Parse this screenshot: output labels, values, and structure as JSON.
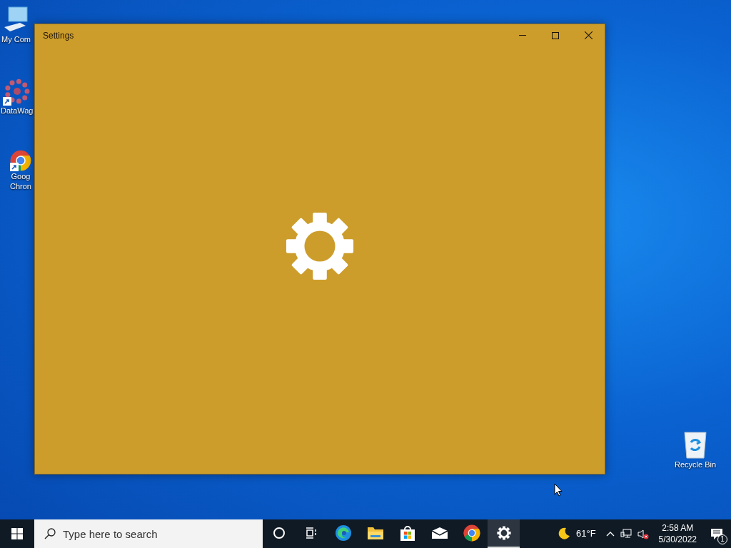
{
  "desktop_icons": [
    {
      "kind": "computer",
      "lines": [
        "My Com"
      ],
      "shortcut": false
    },
    {
      "kind": "network",
      "lines": [
        "DataWag"
      ],
      "shortcut": true
    },
    {
      "kind": "chrome",
      "lines": [
        "Goog",
        "Chron"
      ],
      "shortcut": true
    },
    {
      "kind": "recycle",
      "lines": [
        "Recycle Bin"
      ],
      "shortcut": false
    }
  ],
  "window": {
    "title": "Settings"
  },
  "taskbar": {
    "search": {
      "placeholder": "Type here to search"
    },
    "apps": [
      {
        "kind": "cortana",
        "selected": false
      },
      {
        "kind": "taskview",
        "selected": false
      },
      {
        "kind": "edge",
        "selected": false
      },
      {
        "kind": "explorer",
        "selected": false
      },
      {
        "kind": "store",
        "selected": false
      },
      {
        "kind": "mail",
        "selected": false
      },
      {
        "kind": "chrome",
        "selected": false
      },
      {
        "kind": "settings",
        "selected": true
      }
    ],
    "weather": "61°F",
    "time": "2:58 AM",
    "date": "5/30/2022",
    "notifications": "1"
  }
}
